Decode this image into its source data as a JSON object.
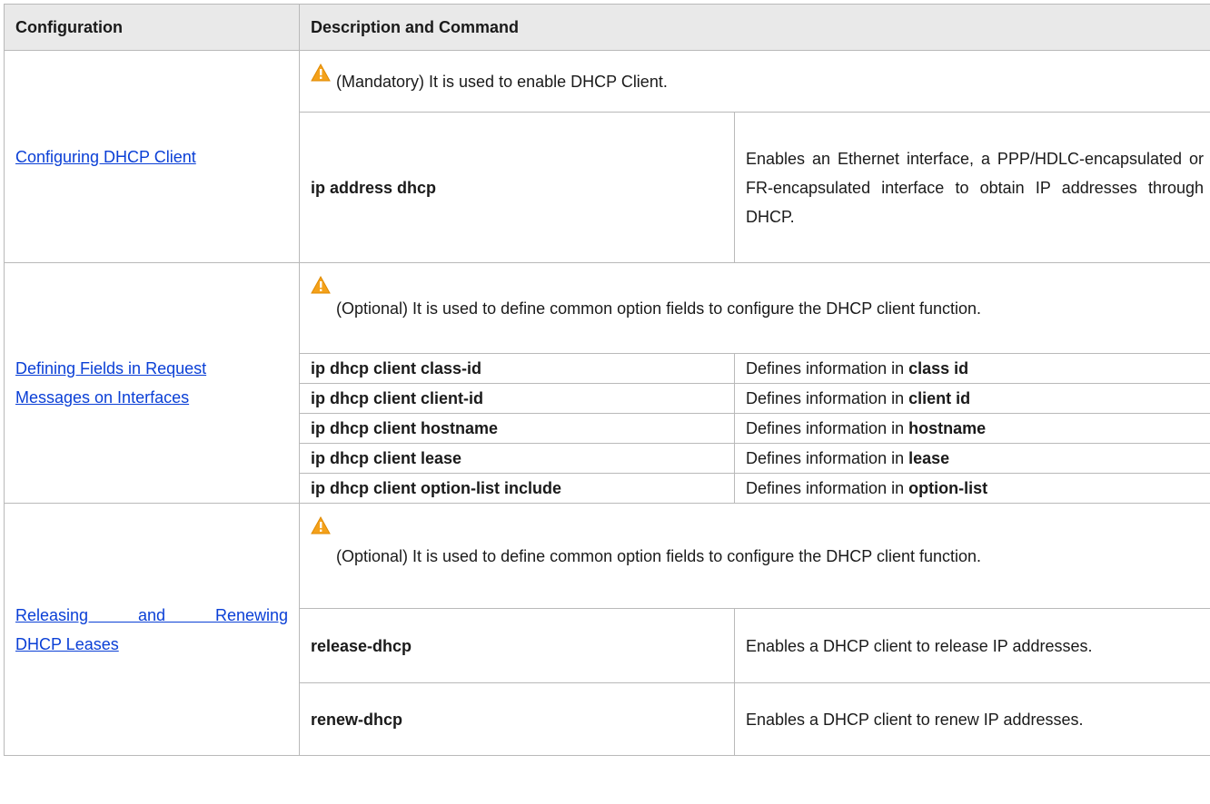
{
  "headers": {
    "configuration": "Configuration",
    "description": "Description and Command"
  },
  "sections": [
    {
      "config": "Configuring DHCP Client",
      "note": "(Mandatory) It is used to enable DHCP Client.",
      "commands": [
        {
          "command": "ip address dhcp",
          "description": "Enables an Ethernet interface, a PPP/HDLC-encapsulated or FR-encapsulated interface to obtain IP addresses through DHCP."
        }
      ]
    },
    {
      "config_line1": "Defining Fields in Request",
      "config_line2": "Messages on Interfaces",
      "note": "(Optional) It is used to define common option fields to configure the DHCP client function.",
      "commands": [
        {
          "command": "ip dhcp client class-id",
          "desc_prefix": "Defines information in ",
          "desc_bold": "class id"
        },
        {
          "command": "ip dhcp client client-id",
          "desc_prefix": "Defines information in ",
          "desc_bold": "client id"
        },
        {
          "command": "ip dhcp client hostname",
          "desc_prefix": "Defines information in ",
          "desc_bold": "hostname"
        },
        {
          "command": "ip dhcp client lease",
          "desc_prefix": "Defines information in ",
          "desc_bold": "lease"
        },
        {
          "command": "ip dhcp client option-list include",
          "desc_prefix": "Defines information in ",
          "desc_bold": "option-list"
        }
      ]
    },
    {
      "config_line1": "Releasing and Renewing",
      "config_line2": "DHCP Leases",
      "note": "(Optional) It is used to define common option fields to configure the DHCP client function.",
      "commands": [
        {
          "command": "release-dhcp",
          "description": "Enables a DHCP client to release IP addresses."
        },
        {
          "command": "renew-dhcp",
          "description": "Enables a DHCP client to renew IP addresses."
        }
      ]
    }
  ],
  "icons": {
    "warning": "warning-icon",
    "warning_color": "#f4a11a"
  },
  "colors": {
    "link": "#0a3fd6",
    "header_bg": "#e9e9e9",
    "border": "#b9b9b9"
  }
}
